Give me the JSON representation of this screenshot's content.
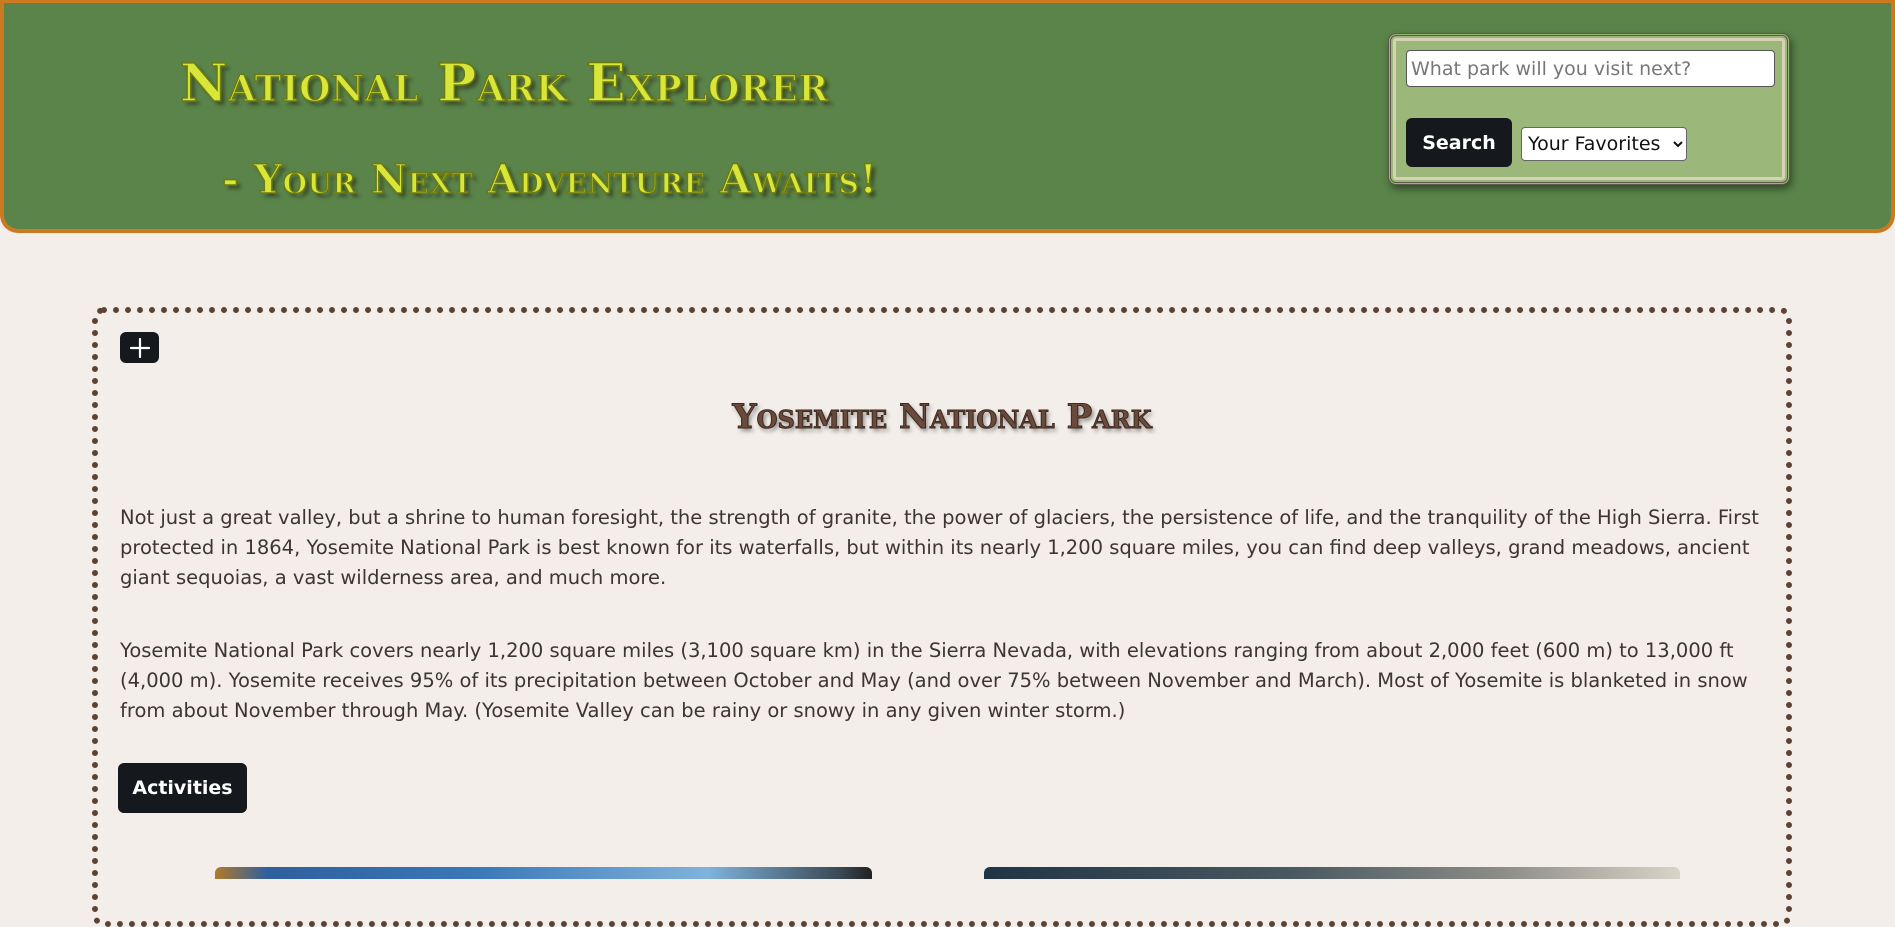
{
  "header": {
    "title": "National Park Explorer",
    "subtitle": "- Your Next Adventure Awaits!",
    "colors": {
      "background": "#5a8449",
      "border": "#cc7a22",
      "title_text": "#d8e63a"
    }
  },
  "search": {
    "placeholder": "What park will you visit next?",
    "value": "",
    "button_label": "Search",
    "favorites_selected": "Your Favorites",
    "favorites_options": [
      "Your Favorites"
    ],
    "panel_color": "#9bb87a"
  },
  "park": {
    "add_icon": "plus-icon",
    "name": "Yosemite National Park",
    "description_1": "Not just a great valley, but a shrine to human foresight, the strength of granite, the power of glaciers, the persistence of life, and the tranquility of the High Sierra. First protected in 1864, Yosemite National Park is best known for its waterfalls, but within its nearly 1,200 square miles, you can find deep valleys, grand meadows, ancient giant sequoias, a vast wilderness area, and much more.",
    "description_2": "Yosemite National Park covers nearly 1,200 square miles (3,100 square km) in the Sierra Nevada, with elevations ranging from about 2,000 feet (600 m) to 13,000 ft (4,000 m). Yosemite receives 95% of its precipitation between October and May (and over 75% between November and March). Most of Yosemite is blanketed in snow from about November through May. (Yosemite Valley can be rainy or snowy in any given winter storm.)",
    "activities_label": "Activities",
    "card_border_color": "#5c4434"
  },
  "theme": {
    "page_background": "#f3eeea",
    "button_background": "#15181c",
    "body_text": "#3e3430"
  }
}
